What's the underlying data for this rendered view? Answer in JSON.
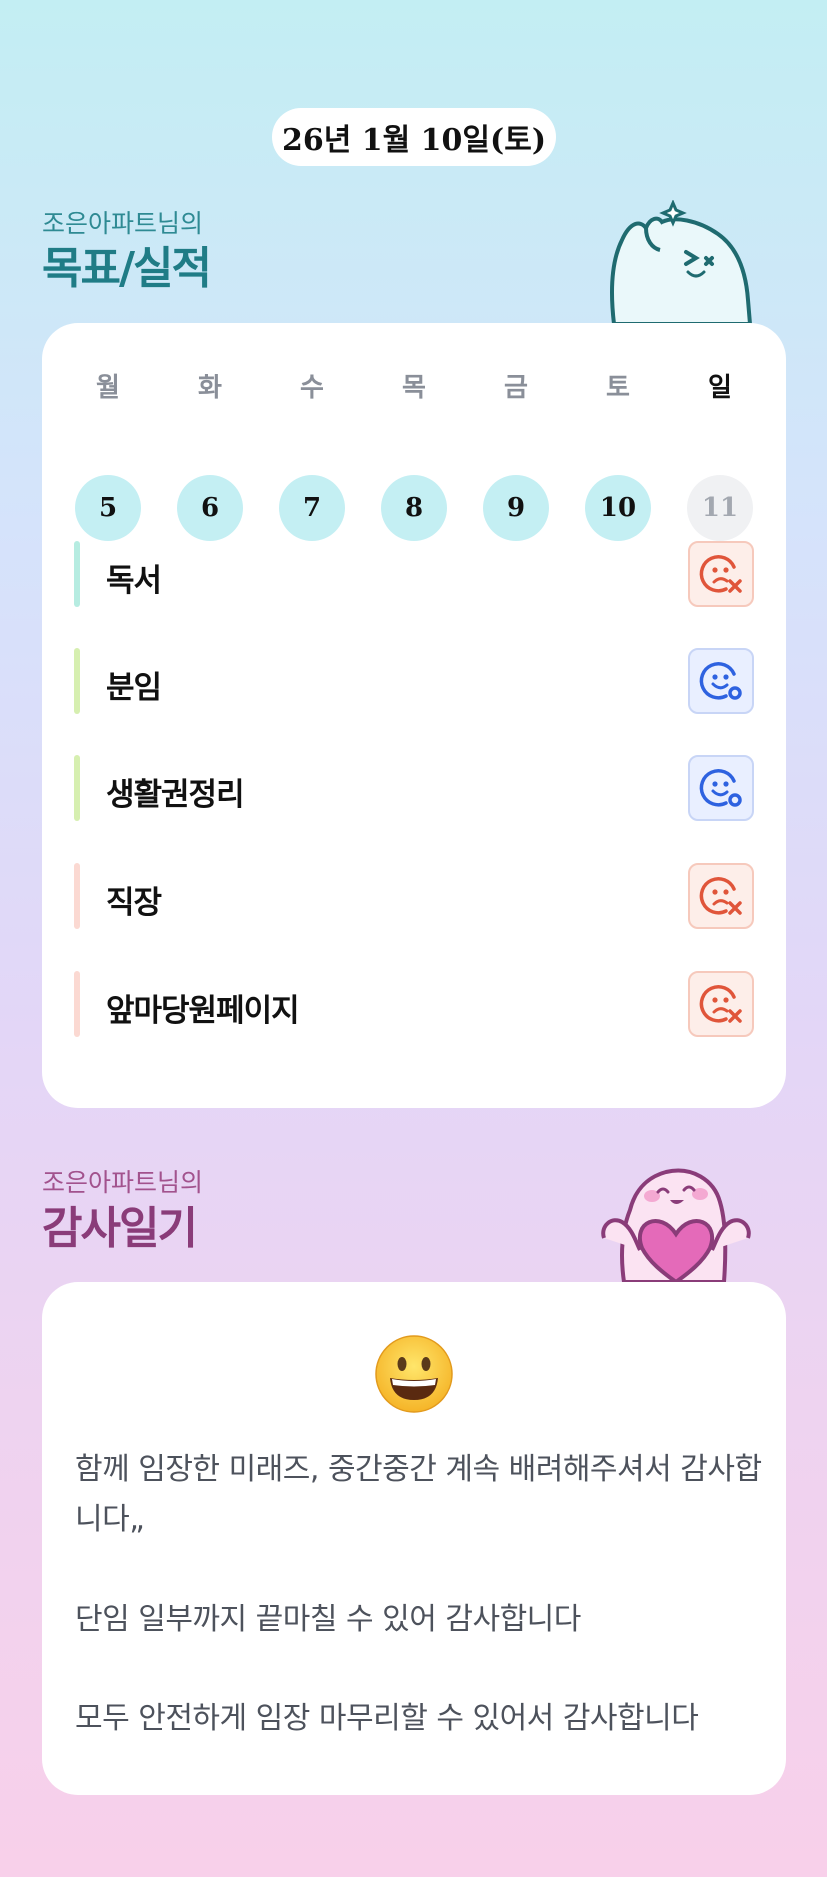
{
  "date_label": "26년 1월 10일(토)",
  "goals_section": {
    "subtitle": "조은아파트님의",
    "title": "목표/실적"
  },
  "week": {
    "days": [
      {
        "weekday": "월",
        "date": "5",
        "state": "done"
      },
      {
        "weekday": "화",
        "date": "6",
        "state": "done"
      },
      {
        "weekday": "수",
        "date": "7",
        "state": "done"
      },
      {
        "weekday": "목",
        "date": "8",
        "state": "done"
      },
      {
        "weekday": "금",
        "date": "9",
        "state": "done"
      },
      {
        "weekday": "토",
        "date": "10",
        "state": "done"
      },
      {
        "weekday": "일",
        "date": "11",
        "state": "future"
      }
    ]
  },
  "goals": [
    {
      "label": "독서",
      "bar_color": "#b6ece1",
      "status": "sad-x-icon"
    },
    {
      "label": "분임",
      "bar_color": "#d6efb0",
      "status": "smile-o-icon"
    },
    {
      "label": "생활권정리",
      "bar_color": "#d6efb0",
      "status": "smile-o-icon"
    },
    {
      "label": "직장",
      "bar_color": "#fbd9d2",
      "status": "sad-x-icon"
    },
    {
      "label": "앞마당원페이지",
      "bar_color": "#fbd9d2",
      "status": "sad-x-icon"
    }
  ],
  "gratitude_section": {
    "subtitle": "조은아파트님의",
    "title": "감사일기",
    "mood_icon": "grinning-face-icon",
    "entries": [
      "함께 임장한 미래즈, 중간중간 계속 배려해주셔서 감사합니다„",
      "단임 일부까지 끝마칠 수 있어 감사합니다",
      "모두 안전하게 임장 마무리할 수 있어서 감사합니다"
    ]
  },
  "colors": {
    "fail": "#e0553a",
    "ok": "#2e62e0",
    "goals_accent": "#1f7c86",
    "gratitude_accent": "#8a3c79"
  }
}
